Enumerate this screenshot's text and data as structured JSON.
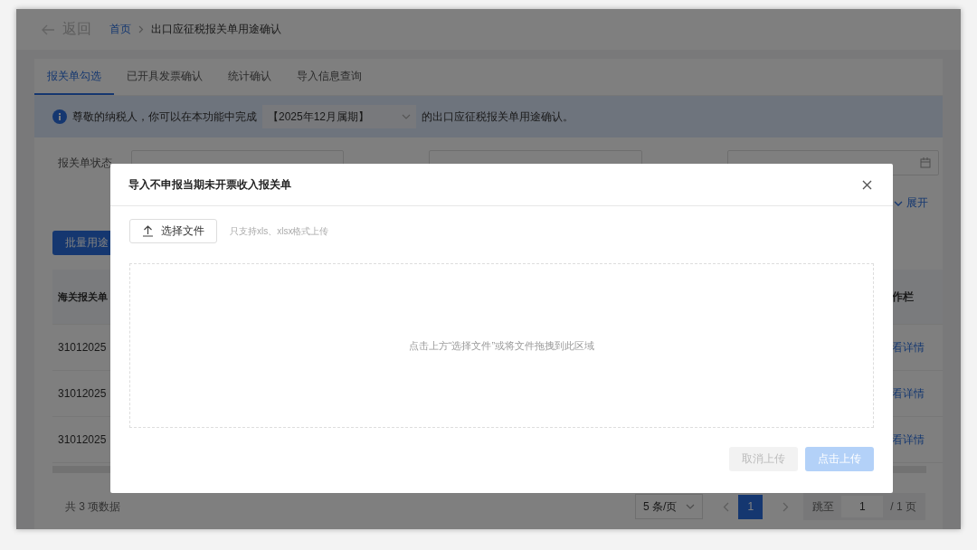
{
  "header": {
    "back_label": "返回",
    "breadcrumb": [
      {
        "label": "首页",
        "link": true
      },
      {
        "label": "出口应征税报关单用途确认",
        "link": false
      }
    ]
  },
  "tabs": [
    {
      "label": "报关单勾选",
      "selected": true
    },
    {
      "label": "已开具发票确认",
      "selected": false
    },
    {
      "label": "统计确认",
      "selected": false
    },
    {
      "label": "导入信息查询",
      "selected": false
    }
  ],
  "notice": {
    "prefix": "尊敬的纳税人，你可以在本功能中完成",
    "period": "【2025年12月属期】",
    "suffix": "的出口应征税报关单用途确认。"
  },
  "filters": {
    "status_label": "报关单状态"
  },
  "expand_link": "展开",
  "batch_button": "批量用途",
  "table": {
    "columns": [
      "海关报关单",
      "作栏"
    ],
    "rows": [
      {
        "number": "31012025",
        "action": "看详情"
      },
      {
        "number": "31012025",
        "action": "看详情"
      },
      {
        "number": "31012025",
        "action": "看详情"
      }
    ]
  },
  "footer": {
    "total": "共 3 项数据",
    "page_size": "5 条/页",
    "pages": [
      {
        "label": "1",
        "selected": true
      }
    ],
    "jump_label": "跳至",
    "jump_value": "1",
    "total_pages": "/ 1 页"
  },
  "dialog": {
    "title": "导入不申报当期未开票收入报关单",
    "choose_button": "选择文件",
    "hint": "只支持xls、xlsx格式上传",
    "drop_text": "点击上方“选择文件”或将文件拖拽到此区域",
    "buttons": [
      {
        "label": "取消上传",
        "kind": "secondary",
        "disabled": true
      },
      {
        "label": "点击上传",
        "kind": "primary",
        "disabled": true
      }
    ]
  }
}
